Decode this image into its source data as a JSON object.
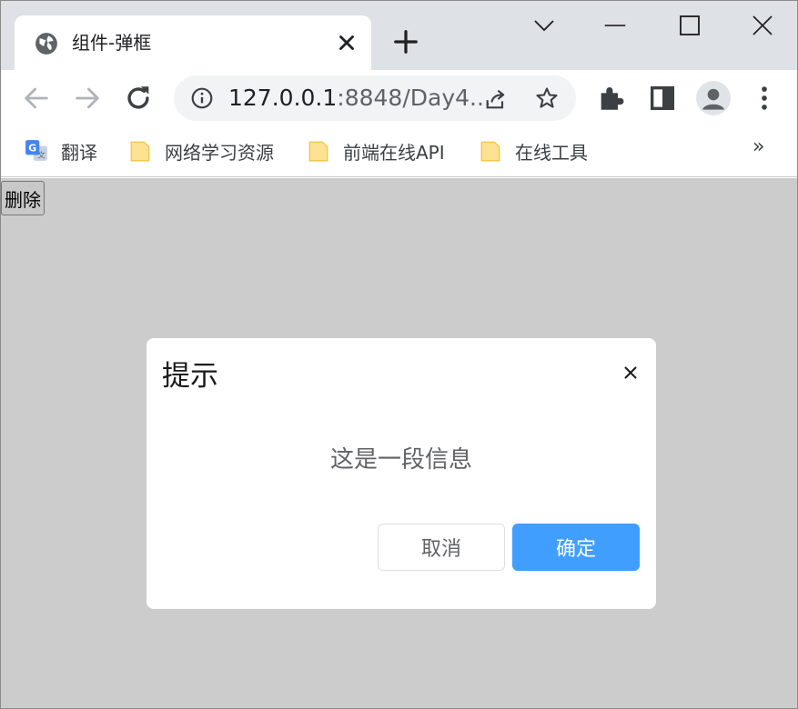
{
  "tab": {
    "title": "组件-弹框"
  },
  "omnibox": {
    "host": "127.0.0.1",
    "rest": ":8848/Day4..."
  },
  "bookmarks": [
    {
      "label": "翻译",
      "icon": "google-translate-icon"
    },
    {
      "label": "网络学习资源",
      "icon": "folder-icon"
    },
    {
      "label": "前端在线API",
      "icon": "folder-icon"
    },
    {
      "label": "在线工具",
      "icon": "folder-icon"
    }
  ],
  "bookmarks_more": "»",
  "page": {
    "delete_label": "删除"
  },
  "dialog": {
    "title": "提示",
    "message": "这是一段信息",
    "cancel_label": "取消",
    "ok_label": "确定"
  },
  "colors": {
    "primary": "#409eff",
    "overlay": "#cccccc",
    "tabstrip": "#dee1e6"
  }
}
